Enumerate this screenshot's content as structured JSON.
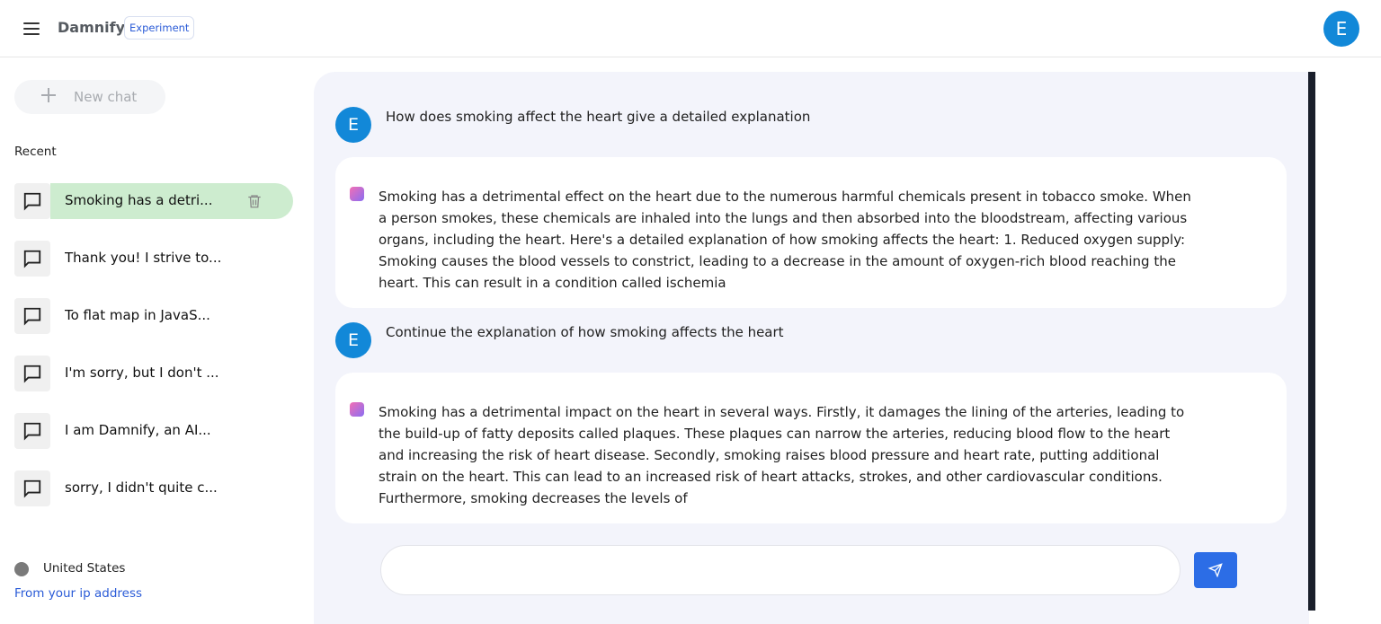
{
  "header": {
    "brand": "Damnify",
    "badge": "Experiment",
    "avatar_letter": "E"
  },
  "sidebar": {
    "new_chat_label": "New chat",
    "recent_title": "Recent",
    "items": [
      {
        "label": "Smoking has a detri...",
        "active": true
      },
      {
        "label": "Thank you! I strive to..."
      },
      {
        "label": "To flat map in JavaS..."
      },
      {
        "label": "I'm sorry, but I don't ..."
      },
      {
        "label": "I am Damnify, an AI..."
      },
      {
        "label": "sorry, I didn't quite c..."
      }
    ],
    "location": "United States",
    "location_link": "From your ip address"
  },
  "conversation": [
    {
      "role": "user",
      "avatar": "E",
      "text": "How does smoking affect the heart give a detailed explanation"
    },
    {
      "role": "assistant",
      "text": "Smoking has a detrimental effect on the heart due to the numerous harmful chemicals present in tobacco smoke. When a person smokes, these chemicals are inhaled into the lungs and then absorbed into the bloodstream, affecting various organs, including the heart. Here's a detailed explanation of how smoking affects the heart: 1. Reduced oxygen supply: Smoking causes the blood vessels to constrict, leading to a decrease in the amount of oxygen-rich blood reaching the heart. This can result in a condition called ischemia"
    },
    {
      "role": "user",
      "avatar": "E",
      "text": "Continue the explanation of how smoking affects the heart"
    },
    {
      "role": "assistant",
      "text": "Smoking has a detrimental impact on the heart in several ways. Firstly, it damages the lining of the arteries, leading to the build-up of fatty deposits called plaques. These plaques can narrow the arteries, reducing blood flow to the heart and increasing the risk of heart disease. Secondly, smoking raises blood pressure and heart rate, putting additional strain on the heart. This can lead to an increased risk of heart attacks, strokes, and other cardiovascular conditions. Furthermore, smoking decreases the levels of"
    }
  ],
  "prompt": {
    "value": "",
    "placeholder": ""
  },
  "colors": {
    "accent": "#2c6de6",
    "avatar": "#1288d8",
    "active_chat": "#cdeccf",
    "main_bg": "#f3f4fb"
  },
  "icons": {
    "menu": "menu-icon",
    "plus": "plus-icon",
    "chat": "chat-bubble-icon",
    "trash": "trash-icon",
    "assistant": "gemini-sparkle-icon",
    "send": "send-icon"
  }
}
